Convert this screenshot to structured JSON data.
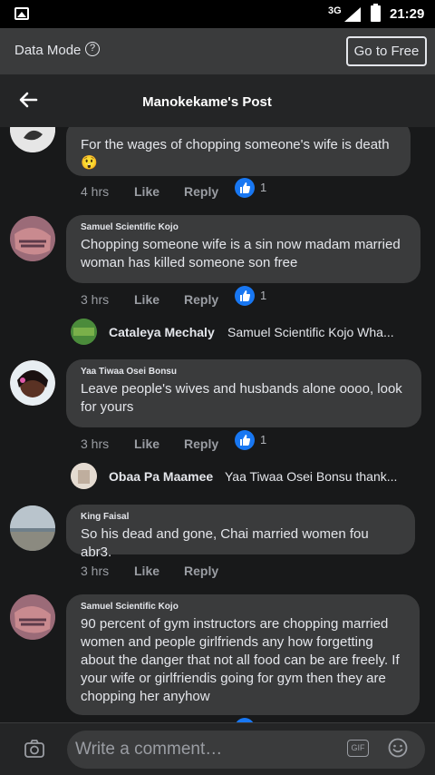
{
  "status_bar": {
    "network": "3G",
    "time": "21:29"
  },
  "data_mode": {
    "label": "Data Mode",
    "help_glyph": "?",
    "button_label": "Go to Free"
  },
  "header": {
    "title": "Manokekame's Post"
  },
  "comments": [
    {
      "text": "For the wages of chopping someone's wife is death",
      "emoji": "😲",
      "time": "4 hrs",
      "like_label": "Like",
      "reply_label": "Reply",
      "reaction_count": "1"
    },
    {
      "name": "Samuel Scientific Kojo",
      "text": "Chopping someone wife is a sin now madam married woman has killed someone son free",
      "time": "3 hrs",
      "like_label": "Like",
      "reply_label": "Reply",
      "reaction_count": "1",
      "reply_preview": {
        "name": "Cataleya Mechaly",
        "text": "Samuel Scientific Kojo Wha..."
      }
    },
    {
      "name": "Yaa Tiwaa Osei Bonsu",
      "text": "Leave people's wives and husbands alone oooo, look for yours",
      "time": "3 hrs",
      "like_label": "Like",
      "reply_label": "Reply",
      "reaction_count": "1",
      "reply_preview": {
        "name": "Obaa Pa Maamee",
        "text": "Yaa Tiwaa Osei Bonsu thank..."
      }
    },
    {
      "name": "King Faisal",
      "text": "So his dead and gone, Chai married women fou abr3.",
      "time": "3 hrs",
      "like_label": "Like",
      "reply_label": "Reply"
    },
    {
      "name": "Samuel Scientific Kojo",
      "text": "90 percent of gym instructors are chopping married women and people girlfriends any how forgetting about the danger that not all food can be are freely. If your wife or girlfriendis going for gym then they are chopping her anyhow"
    }
  ],
  "composer": {
    "placeholder": "Write a comment…",
    "gif_label": "GIF"
  },
  "colors": {
    "background": "#18191a",
    "bubble": "#3a3b3c",
    "bars": "#242526",
    "reaction_blue": "#1877f2"
  },
  "icons": [
    "image-icon",
    "signal-icon",
    "battery-icon",
    "help-icon",
    "back-arrow-icon",
    "like-reaction-icon",
    "camera-icon",
    "gif-icon",
    "emoji-icon"
  ]
}
